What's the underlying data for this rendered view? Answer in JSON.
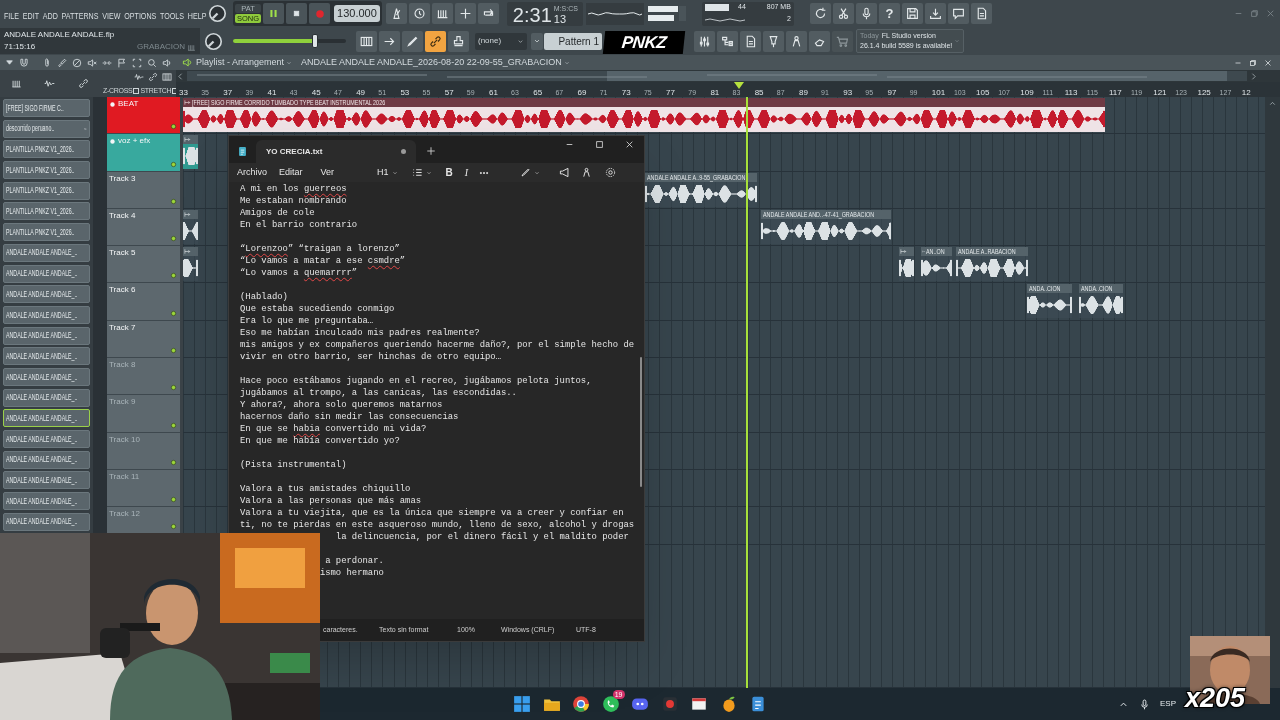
{
  "menu": [
    "FILE",
    "EDIT",
    "ADD",
    "PATTERNS",
    "VIEW",
    "OPTIONS",
    "TOOLS",
    "HELP"
  ],
  "project": {
    "file": "ANDALE ANDALE ANDALE.flp",
    "time": "71:15:16",
    "hint": "GRABACION"
  },
  "transport": {
    "modes": [
      {
        "label": "PAT",
        "selected": false
      },
      {
        "label": "SONG",
        "selected": true
      }
    ],
    "playing": true,
    "tempo": "130.000"
  },
  "clock": {
    "time": "2:31",
    "unit": "M:S:CS",
    "centis": "13"
  },
  "monitor": {
    "cpu": "44",
    "memory": "807 MB",
    "polyphony": "2"
  },
  "help": "?",
  "master_volume": {
    "level": 0.73
  },
  "link_mode": {
    "on": true
  },
  "snap": "(none)",
  "pattern": "Pattern 1",
  "logo": "PNKZ",
  "update": {
    "when": "Today",
    "title": "FL Studio version",
    "detail": "26.1.4 build 5589 is available!"
  },
  "playlist": {
    "title": "Playlist - Arrangement",
    "arrangement": "ANDALE ANDALE ANDALE_2026-08-20 22-09-55_GRABACION",
    "toggles": [
      {
        "label": "Z-CROSS",
        "checked": false
      },
      {
        "label": "STRETCH",
        "checked": false
      }
    ],
    "ruler": [
      "33",
      "35",
      "37",
      "39",
      "41",
      "43",
      "45",
      "47",
      "49",
      "51",
      "53",
      "55",
      "57",
      "59",
      "61",
      "63",
      "65",
      "67",
      "69",
      "71",
      "73",
      "75",
      "77",
      "79",
      "81",
      "83",
      "85",
      "87",
      "89",
      "91",
      "93",
      "95",
      "97",
      "99",
      "101",
      "103",
      "105",
      "107",
      "109",
      "111",
      "113",
      "115",
      "117",
      "119",
      "121",
      "123",
      "125",
      "127",
      "12"
    ],
    "playhead": {
      "level": 0.52
    },
    "browser": [
      {
        "label": "[FREE] SIGO FIRME C..",
        "kind": "audio",
        "selected": false
      },
      {
        "label": "descorrido peruano..",
        "kind": "audio",
        "selected": false
      },
      {
        "label": "PLANTILLA PNKZ V1_2026..",
        "kind": "project",
        "selected": false
      },
      {
        "label": "PLANTILLA PNKZ V1_2026..",
        "kind": "project",
        "selected": false
      },
      {
        "label": "PLANTILLA PNKZ V1_2026..",
        "kind": "project",
        "selected": false
      },
      {
        "label": "PLANTILLA PNKZ V1_2026..",
        "kind": "project",
        "selected": false
      },
      {
        "label": "PLANTILLA PNKZ V1_2026..",
        "kind": "project",
        "selected": false
      },
      {
        "label": "ANDALE ANDALE ANDALE_..",
        "kind": "project",
        "selected": false
      },
      {
        "label": "ANDALE ANDALE ANDALE_..",
        "kind": "project",
        "selected": false
      },
      {
        "label": "ANDALE ANDALE ANDALE_..",
        "kind": "project",
        "selected": false
      },
      {
        "label": "ANDALE ANDALE ANDALE_..",
        "kind": "project",
        "selected": false
      },
      {
        "label": "ANDALE ANDALE ANDALE_..",
        "kind": "project",
        "selected": false
      },
      {
        "label": "ANDALE ANDALE ANDALE_..",
        "kind": "project",
        "selected": false
      },
      {
        "label": "ANDALE ANDALE ANDALE_..",
        "kind": "project",
        "selected": false
      },
      {
        "label": "ANDALE ANDALE ANDALE_..",
        "kind": "project",
        "selected": false
      },
      {
        "label": "ANDALE ANDALE ANDALE_..",
        "kind": "project",
        "selected": true
      },
      {
        "label": "ANDALE ANDALE ANDALE_..",
        "kind": "project",
        "selected": false
      },
      {
        "label": "ANDALE ANDALE ANDALE_..",
        "kind": "project",
        "selected": false
      },
      {
        "label": "ANDALE ANDALE ANDALE_..",
        "kind": "project",
        "selected": false
      },
      {
        "label": "ANDALE ANDALE ANDALE_..",
        "kind": "project",
        "selected": false
      },
      {
        "label": "ANDALE ANDALE ANDALE_..",
        "kind": "project",
        "selected": false
      }
    ],
    "tracks": [
      {
        "name": "BEAT",
        "kind": "beat",
        "color": "#e01a22",
        "dimmed": false,
        "clips": [
          {
            "kind": "audio",
            "label": "[FREE] SIGO FIRME CORRIDO TUMBADO TYPE BEAT INSTRUMENTAL 2026"
          }
        ]
      },
      {
        "name": "voz + efx",
        "kind": "voice",
        "color": "#38a99e",
        "dimmed": false,
        "clips": [
          {
            "kind": "audio"
          }
        ]
      },
      {
        "name": "Track 3",
        "kind": "audio",
        "color": "#5d686e",
        "dimmed": false,
        "clips": [
          {
            "kind": "audio",
            "label": "ANDALE ANDALE A..9-55_GRABACION"
          }
        ]
      },
      {
        "name": "Track 4",
        "kind": "audio",
        "color": "#5d686e",
        "dimmed": false,
        "clips": [
          {
            "kind": "audio"
          },
          {
            "kind": "audio",
            "label": "ANDALE ANDALE AND..-47-41_GRABACION"
          }
        ]
      },
      {
        "name": "Track 5",
        "kind": "audio",
        "color": "#5d686e",
        "dimmed": false,
        "clips": [
          {
            "kind": "audio"
          },
          {
            "kind": "audio"
          },
          {
            "kind": "audio",
            "label": "AN..ON"
          },
          {
            "kind": "audio",
            "label": "ANDALE A..RABACION"
          }
        ]
      },
      {
        "name": "Track 6",
        "kind": "audio",
        "color": "#5d686e",
        "dimmed": false,
        "clips": [
          {
            "kind": "audio",
            "label": "ANDA..CION"
          },
          {
            "kind": "audio",
            "label": "ANDA..CION"
          }
        ]
      },
      {
        "name": "Track 7",
        "kind": "audio",
        "color": "#5d686e",
        "dimmed": false
      },
      {
        "name": "Track 8",
        "kind": "audio",
        "color": "#5d686e",
        "dimmed": true
      },
      {
        "name": "Track 9",
        "kind": "audio",
        "color": "#5d686e",
        "dimmed": true
      },
      {
        "name": "Track 10",
        "kind": "audio",
        "color": "#5d686e",
        "dimmed": true
      },
      {
        "name": "Track 11",
        "kind": "audio",
        "color": "#5d686e",
        "dimmed": true
      },
      {
        "name": "Track 12",
        "kind": "audio",
        "color": "#5d686e",
        "dimmed": true
      }
    ]
  },
  "notepad": {
    "tab": "YO CRECIA.txt",
    "modified": true,
    "menu": [
      "Archivo",
      "Editar",
      "Ver"
    ],
    "heading": "H1",
    "bold": "B",
    "italic": "I",
    "lines": [
      {
        "kind": "text",
        "segments": [
          {
            "text": "A mi en los "
          },
          {
            "text": "guerreos",
            "misspelled": true
          }
        ]
      },
      {
        "kind": "text",
        "segments": [
          {
            "text": "Me estaban nombrando"
          }
        ]
      },
      {
        "kind": "text",
        "segments": [
          {
            "text": "Amigos de cole"
          }
        ]
      },
      {
        "kind": "text",
        "segments": [
          {
            "text": "En el barrio contrario"
          }
        ]
      },
      {
        "kind": "blank"
      },
      {
        "kind": "text",
        "segments": [
          {
            "text": "“"
          },
          {
            "text": "Lorenzoo",
            "misspelled": true
          },
          {
            "text": "” “traigan a lorenzo”"
          }
        ]
      },
      {
        "kind": "text",
        "segments": [
          {
            "text": "“Lo vamos a matar a ese "
          },
          {
            "text": "csmdre",
            "misspelled": true
          },
          {
            "text": "”"
          }
        ]
      },
      {
        "kind": "text",
        "segments": [
          {
            "text": "“Lo vamos a "
          },
          {
            "text": "quemarrrr",
            "misspelled": true
          },
          {
            "text": "”"
          }
        ]
      },
      {
        "kind": "blank"
      },
      {
        "kind": "text",
        "segments": [
          {
            "text": "(Hablado)"
          }
        ]
      },
      {
        "kind": "text",
        "segments": [
          {
            "text": "Que estaba sucediendo conmigo"
          }
        ]
      },
      {
        "kind": "text",
        "segments": [
          {
            "text": "Era lo que me preguntaba…"
          }
        ]
      },
      {
        "kind": "text",
        "segments": [
          {
            "text": "Eso me habían inculcado mis padres realmente?"
          }
        ]
      },
      {
        "kind": "text",
        "segments": [
          {
            "text": "mis amigos y ex compañeros queriendo hacerme daño?, por el simple hecho de"
          }
        ]
      },
      {
        "kind": "text",
        "segments": [
          {
            "text": "vivir en otro barrio, ser hinchas de otro equipo…"
          }
        ]
      },
      {
        "kind": "blank"
      },
      {
        "kind": "text",
        "segments": [
          {
            "text": "Hace poco estábamos jugando en el recreo, jugábamos pelota juntos,"
          }
        ]
      },
      {
        "kind": "text",
        "segments": [
          {
            "text": "jugábamos al trompo, a las canicas, las escondidas.."
          }
        ]
      },
      {
        "kind": "text",
        "segments": [
          {
            "text": "Y ahora?, ahora solo queremos matarnos"
          }
        ]
      },
      {
        "kind": "text",
        "segments": [
          {
            "text": "hacernos daño sin medir las consecuencias"
          }
        ]
      },
      {
        "kind": "text",
        "segments": [
          {
            "text": "En que se "
          },
          {
            "text": "habia",
            "misspelled": true
          },
          {
            "text": " convertido mi vida?"
          }
        ]
      },
      {
        "kind": "text",
        "segments": [
          {
            "text": "En que me había convertido yo?"
          }
        ]
      },
      {
        "kind": "blank"
      },
      {
        "kind": "text",
        "segments": [
          {
            "text": "(Pista instrumental)"
          }
        ]
      },
      {
        "kind": "blank"
      },
      {
        "kind": "text",
        "segments": [
          {
            "text": "Valora a tus amistades chiquillo"
          }
        ]
      },
      {
        "kind": "text",
        "segments": [
          {
            "text": "Valora a las personas que más amas"
          }
        ]
      },
      {
        "kind": "text",
        "segments": [
          {
            "text": "Valora a tu viejita, que es la única que siempre va a creer y confiar en"
          }
        ]
      },
      {
        "kind": "text",
        "segments": [
          {
            "text": "ti, no te pierdas en este asqueroso mundo, lleno de sexo, alcohol y drogas"
          }
        ]
      },
      {
        "kind": "cut",
        "segments": [
          {
            "text": "la delincuencia, por el dinero fácil y el maldito poder"
          }
        ]
      },
      {
        "kind": "blank"
      },
      {
        "kind": "cut",
        "segments": [
          {
            "text": "a perdonar."
          }
        ]
      },
      {
        "kind": "cut",
        "segments": [
          {
            "text": "ismo hermano"
          }
        ]
      }
    ],
    "status": [
      "caracteres.",
      "Texto sin format",
      "100%",
      "Windows (CRLF)",
      "UTF-8"
    ]
  },
  "webcam": {
    "kind": "picture"
  },
  "overlay": {
    "kind": "picture",
    "counter": "x205"
  },
  "taskbar": {
    "apps": [
      {
        "kind": "start"
      },
      {
        "kind": "explorer"
      },
      {
        "kind": "browser"
      },
      {
        "kind": "chat",
        "badge": "19"
      },
      {
        "kind": "voice"
      },
      {
        "kind": "capture"
      },
      {
        "kind": "window"
      },
      {
        "kind": "daw"
      },
      {
        "kind": "notepad"
      }
    ],
    "language": "ESP"
  }
}
